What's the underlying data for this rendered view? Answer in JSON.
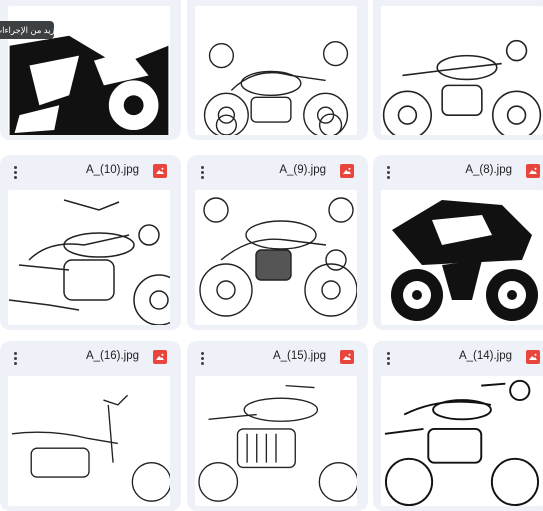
{
  "tooltip": {
    "text": "مزيد من الإجراءات"
  },
  "files": [
    {
      "name": "A_(10).jpg",
      "icon": "image-icon"
    },
    {
      "name": "A_(9).jpg",
      "icon": "image-icon"
    },
    {
      "name": "A_(8).jpg",
      "icon": "image-icon"
    },
    {
      "name": "A_(16).jpg",
      "icon": "image-icon"
    },
    {
      "name": "A_(15).jpg",
      "icon": "image-icon"
    },
    {
      "name": "A_(14).jpg",
      "icon": "image-icon"
    }
  ],
  "colors": {
    "card_bg": "#eef1f7",
    "file_icon": "#e8453c"
  }
}
